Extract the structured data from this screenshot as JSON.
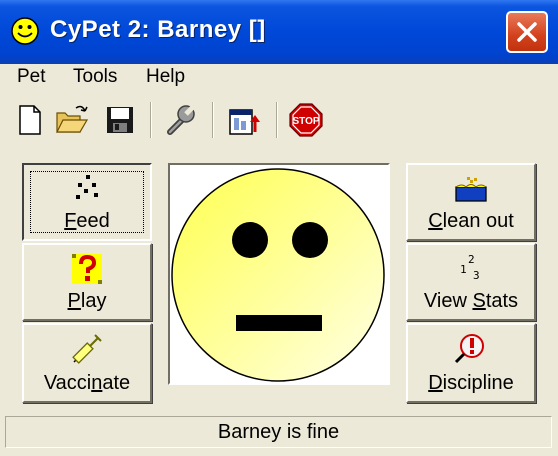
{
  "window": {
    "title": "CyPet 2: Barney []",
    "close_icon": "close-icon",
    "app_icon": "smiley-icon"
  },
  "menu": {
    "items": [
      {
        "label": "Pet"
      },
      {
        "label": "Tools"
      },
      {
        "label": "Help"
      }
    ]
  },
  "toolbar": {
    "icons": [
      "new-file-icon",
      "open-folder-icon",
      "save-icon",
      "wrench-icon",
      "window-export-icon",
      "stop-sign-icon"
    ],
    "stop_text": "STOP"
  },
  "left_buttons": [
    {
      "pre": "",
      "u": "F",
      "post": "eed",
      "icon": "food-pellets-icon",
      "pressed": true
    },
    {
      "pre": "",
      "u": "P",
      "post": "lay",
      "icon": "question-toy-icon",
      "pressed": false
    },
    {
      "pre": "Vacci",
      "u": "n",
      "post": "ate",
      "icon": "syringe-icon",
      "pressed": false
    }
  ],
  "right_buttons": [
    {
      "pre": "",
      "u": "C",
      "post": "lean out",
      "icon": "litter-tray-icon"
    },
    {
      "pre": "View ",
      "u": "S",
      "post": "tats",
      "icon": "stats-numbers-icon",
      "stats_digits": [
        "1",
        "2",
        "3"
      ]
    },
    {
      "pre": "",
      "u": "D",
      "post": "iscipline",
      "icon": "warning-icon"
    }
  ],
  "pet": {
    "mood": "neutral",
    "face_color": "#ffff80"
  },
  "status": {
    "text": "Barney is fine"
  }
}
